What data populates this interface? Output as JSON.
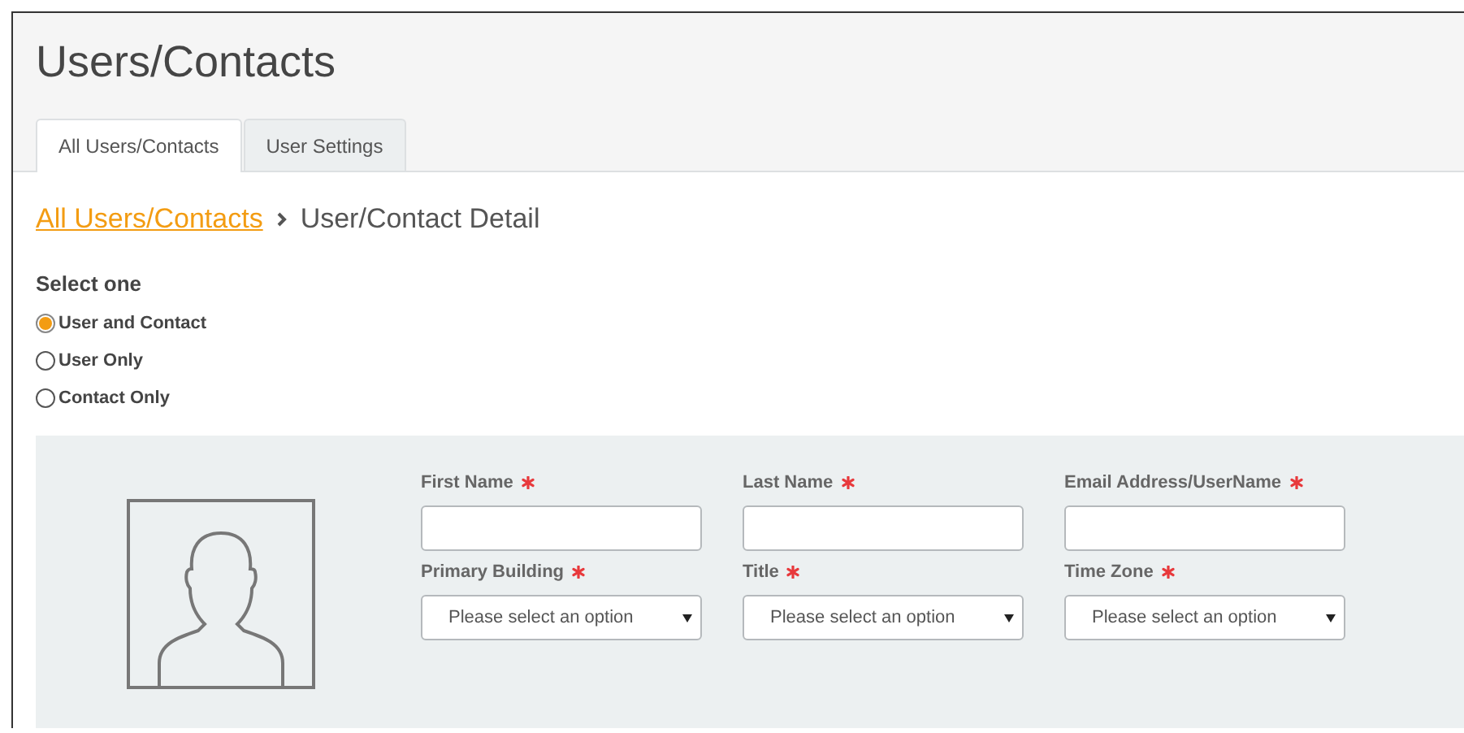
{
  "page": {
    "title": "Users/Contacts"
  },
  "tabs": [
    {
      "label": "All Users/Contacts",
      "selected": true
    },
    {
      "label": "User Settings",
      "selected": false
    }
  ],
  "breadcrumb": {
    "link": "All Users/Contacts",
    "current": "User/Contact Detail"
  },
  "select_one": {
    "label": "Select one",
    "options": [
      {
        "label": "User and Contact",
        "selected": true
      },
      {
        "label": "User Only",
        "selected": false
      },
      {
        "label": "Contact Only",
        "selected": false
      }
    ]
  },
  "form": {
    "fields": [
      {
        "kind": "text",
        "label": "First Name",
        "required": true
      },
      {
        "kind": "text",
        "label": "Last Name",
        "required": true
      },
      {
        "kind": "text",
        "label": "Email Address/UserName",
        "required": true
      },
      {
        "kind": "select",
        "label": "Primary Building",
        "required": true,
        "placeholder": "Please select an option"
      },
      {
        "kind": "select",
        "label": "Title",
        "required": true,
        "placeholder": "Please select an option"
      },
      {
        "kind": "select",
        "label": "Time Zone",
        "required": true,
        "placeholder": "Please select an option"
      }
    ]
  }
}
